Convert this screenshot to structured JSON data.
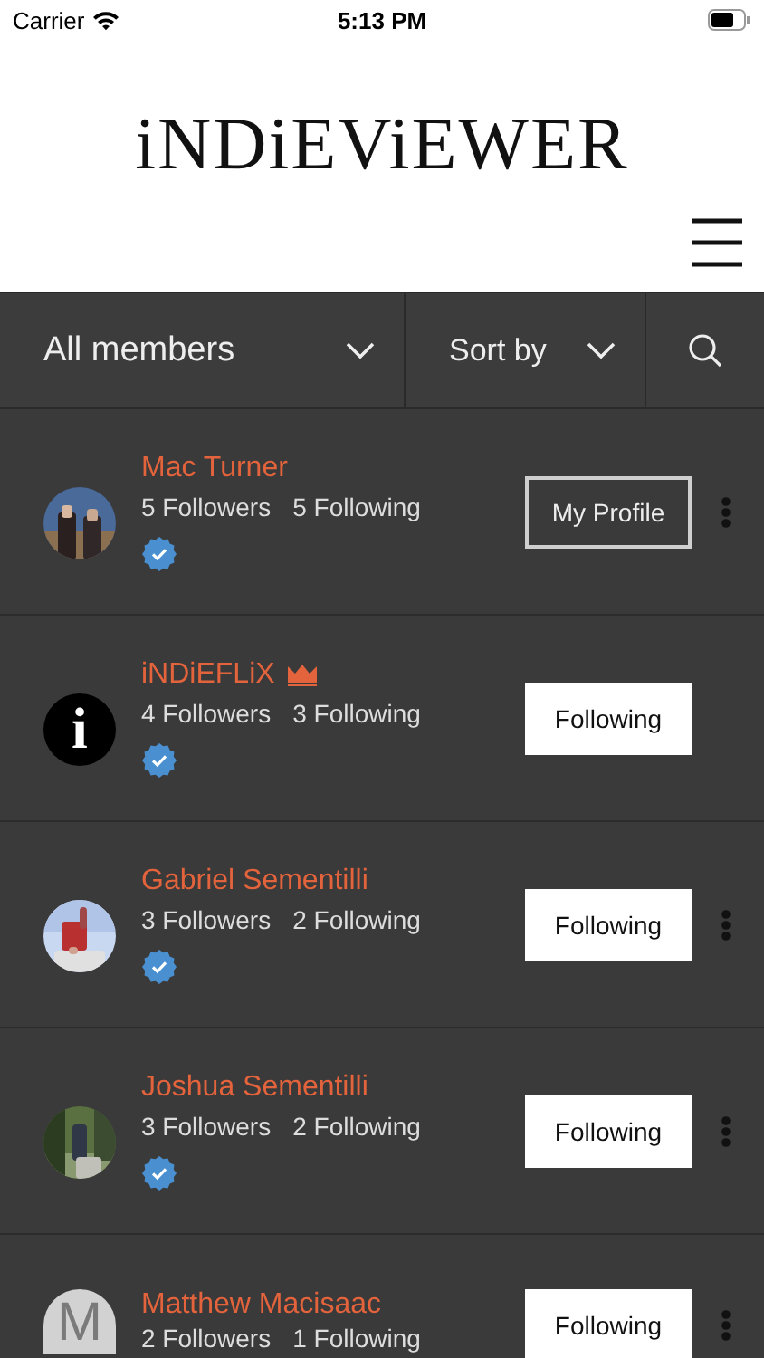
{
  "status_bar": {
    "carrier": "Carrier",
    "time": "5:13 PM"
  },
  "header": {
    "logo": "iNDiEViEWER"
  },
  "filters": {
    "members": "All members",
    "sort": "Sort by"
  },
  "members": [
    {
      "name": "Mac Turner",
      "crown": false,
      "followers": "5 Followers",
      "following": "5 Following",
      "verified": true,
      "button": {
        "label": "My Profile",
        "kind": "profile"
      },
      "menu": true
    },
    {
      "name": "iNDiEFLiX",
      "crown": true,
      "followers": "4 Followers",
      "following": "3 Following",
      "verified": true,
      "avatar": {
        "kind": "logo",
        "letter": "i"
      },
      "button": {
        "label": "Following",
        "kind": "follow"
      },
      "menu": false
    },
    {
      "name": "Gabriel Sementilli",
      "crown": false,
      "followers": "3 Followers",
      "following": "2 Following",
      "verified": true,
      "button": {
        "label": "Following",
        "kind": "follow"
      },
      "menu": true
    },
    {
      "name": "Joshua Sementilli",
      "crown": false,
      "followers": "3 Followers",
      "following": "2 Following",
      "verified": true,
      "button": {
        "label": "Following",
        "kind": "follow"
      },
      "menu": true
    },
    {
      "name": "Matthew Macisaac",
      "crown": false,
      "followers": "2 Followers",
      "following": "1 Following",
      "verified": false,
      "avatar": {
        "kind": "initial",
        "letter": "M"
      },
      "button": {
        "label": "Following",
        "kind": "follow"
      },
      "menu": true
    }
  ]
}
